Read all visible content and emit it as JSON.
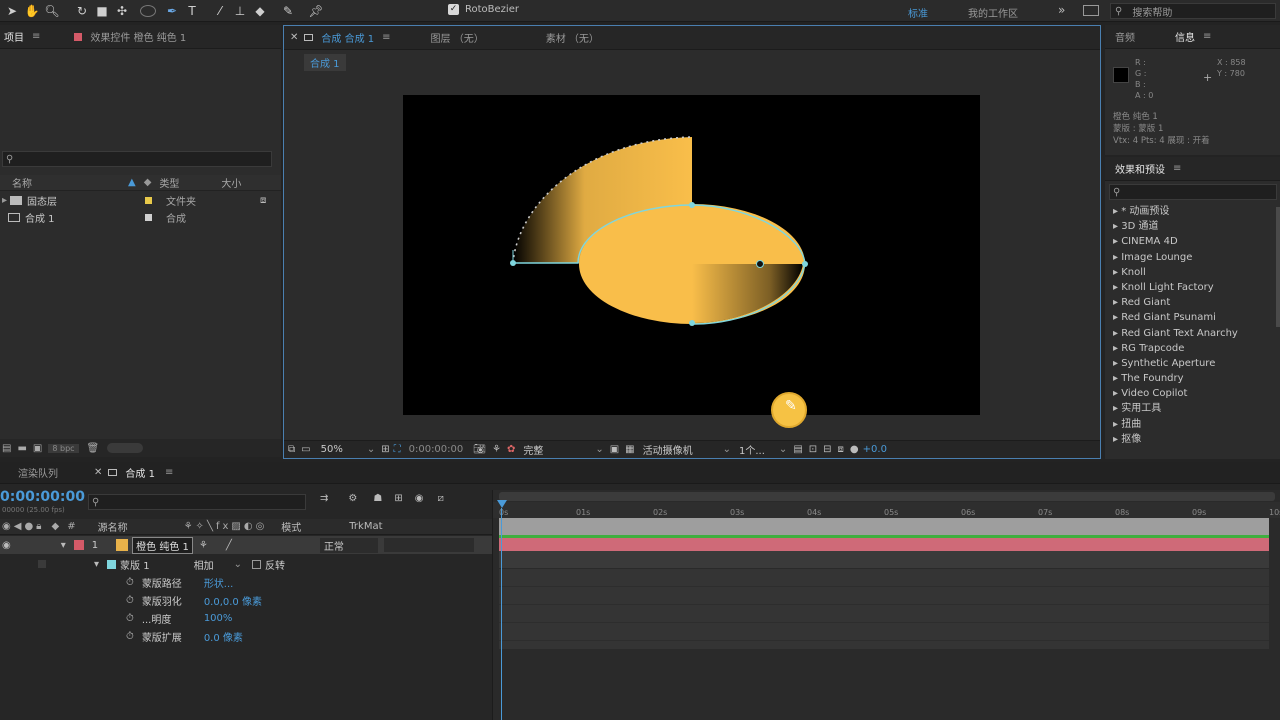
{
  "toolbar": {
    "tools": [
      "selection-tool",
      "hand-tool",
      "zoom-tool",
      "rotate-tool",
      "camera-tool",
      "pan-behind-tool",
      "ellipse-tool",
      "pen-tool",
      "text-tool",
      "brush-tool",
      "clone-stamp-tool",
      "eraser-tool",
      "roto-brush-tool",
      "puppet-pin-tool"
    ],
    "rotobezier_label": "RotoBezier",
    "workspace_standard": "标准",
    "workspace_mine": "我的工作区",
    "search_help": "搜索帮助"
  },
  "project_panel": {
    "tab_label": "项目",
    "effect_controls_label": "效果控件 橙色 纯色 1",
    "columns": {
      "name": "名称",
      "type": "类型",
      "size": "大小"
    },
    "items": [
      {
        "name": "固态层",
        "type": "文件夹"
      },
      {
        "name": "合成 1",
        "type": "合成"
      }
    ],
    "bpc": "8 bpc"
  },
  "comp_panel": {
    "tab_comp": "合成 合成 1",
    "tab_layer": "图层 （无）",
    "tab_footage": "素材 （无）",
    "breadcrumb": "合成 1",
    "zoom": "50%",
    "timecode": "0:00:00:00",
    "resolution": "完整",
    "camera": "活动摄像机",
    "views": "1个...",
    "exposure": "+0.0"
  },
  "info_panel": {
    "tab_audio": "音频",
    "tab_info": "信息",
    "r": "R :",
    "g": "G :",
    "b": "B :",
    "a": "A : 0",
    "x": "X : 858",
    "y": "Y : 780",
    "line1": "橙色 纯色 1",
    "line2": "蒙版 : 蒙版 1",
    "line3": "Vtx: 4 Pts: 4 展现 : 开着"
  },
  "effects_panel": {
    "title": "效果和预设",
    "items": [
      "* 动画预设",
      "3D 通道",
      "CINEMA 4D",
      "Image Lounge",
      "Knoll",
      "Knoll Light Factory",
      "Red Giant",
      "Red Giant Psunami",
      "Red Giant Text Anarchy",
      "RG Trapcode",
      "Synthetic Aperture",
      "The Foundry",
      "Video Copilot",
      "实用工具",
      "扭曲",
      "抠像"
    ]
  },
  "timeline": {
    "tab_render": "渲染队列",
    "tab_comp": "合成 1",
    "timecode": "0:00:00:00",
    "frames": "00000 (25.00 fps)",
    "col_source": "源名称",
    "col_mode": "模式",
    "col_trkmat": "TrkMat",
    "layer_num": "1",
    "layer_name": "橙色 纯色 1",
    "layer_mode": "正常",
    "mask_name": "蒙版 1",
    "mask_mode": "相加",
    "mask_invert": "反转",
    "props": [
      {
        "name": "蒙版路径",
        "value": "形状..."
      },
      {
        "name": "蒙版羽化",
        "value": "0.0,0.0 像素"
      },
      {
        "name": "...明度",
        "value": "100%"
      },
      {
        "name": "蒙版扩展",
        "value": "0.0 像素"
      }
    ],
    "ruler_ticks": [
      "0s",
      "01s",
      "02s",
      "03s",
      "04s",
      "05s",
      "06s",
      "07s",
      "08s",
      "09s",
      "10s"
    ]
  },
  "colors": {
    "accent": "#4a9ad8",
    "label_red": "#d45a68",
    "layer_bar": "#cf6a78",
    "track_green": "#3fae3f",
    "fill": "#f9be4a"
  }
}
